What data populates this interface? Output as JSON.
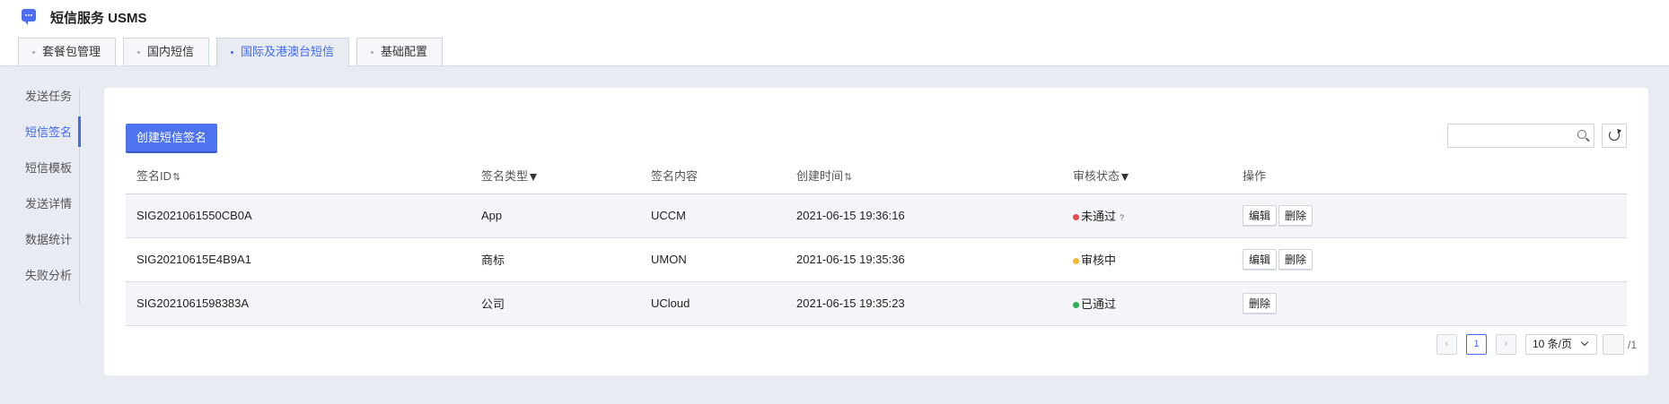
{
  "app": {
    "title": "短信服务 USMS",
    "icon": "message-icon",
    "accent": "#3f6af1"
  },
  "tabs": [
    {
      "label": "套餐包管理",
      "active": false
    },
    {
      "label": "国内短信",
      "active": false
    },
    {
      "label": "国际及港澳台短信",
      "active": true
    },
    {
      "label": "基础配置",
      "active": false
    }
  ],
  "sidebar": {
    "items": [
      {
        "label": "发送任务",
        "active": false
      },
      {
        "label": "短信签名",
        "active": true
      },
      {
        "label": "短信模板",
        "active": false
      },
      {
        "label": "发送详情",
        "active": false
      },
      {
        "label": "数据统计",
        "active": false
      },
      {
        "label": "失败分析",
        "active": false
      }
    ]
  },
  "toolbar": {
    "create_label": "创建短信签名",
    "search_placeholder": "",
    "search_icon": "search-icon",
    "refresh_icon": "refresh-icon"
  },
  "table": {
    "headers": {
      "id": "签名ID",
      "type": "签名类型",
      "content": "签名内容",
      "created": "创建时间",
      "status": "审核状态",
      "ops": "操作"
    },
    "rows": [
      {
        "id": "SIG2021061550CB0A",
        "type": "App",
        "content": "UCCM",
        "created": "2021-06-15 19:36:16",
        "status": "未通过",
        "status_color": "#e94b4b",
        "help": "?",
        "edit": "编辑",
        "delete": "删除"
      },
      {
        "id": "SIG20210615E4B9A1",
        "type": "商标",
        "content": "UMON",
        "created": "2021-06-15 19:35:36",
        "status": "审核中",
        "status_color": "#f5b82e",
        "help": "",
        "edit": "编辑",
        "delete": "删除"
      },
      {
        "id": "SIG2021061598383A",
        "type": "公司",
        "content": "UCloud",
        "created": "2021-06-15 19:35:23",
        "status": "已通过",
        "status_color": "#2aae4f",
        "help": "",
        "edit": "",
        "delete": "删除"
      }
    ]
  },
  "pagination": {
    "current_page": "1",
    "page_size": "10 条/页",
    "jump_value": "",
    "total_pages": "/1"
  }
}
